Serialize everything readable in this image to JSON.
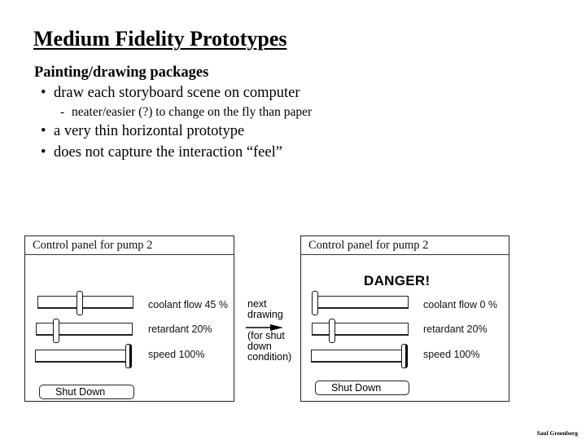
{
  "slide": {
    "title": "Medium Fidelity Prototypes",
    "heading": "Painting/drawing packages",
    "bullet_glyph": "•",
    "sub_glyph": "-",
    "bullets": [
      {
        "text": "draw each storyboard scene on computer",
        "sub": [
          "neater/easier (?) to change on the fly than paper"
        ]
      },
      {
        "text": "a very thin horizontal prototype"
      },
      {
        "text": "does not capture the interaction “feel”"
      }
    ],
    "credit": "Saul Greenberg"
  },
  "storyboard": {
    "transition": {
      "lines": [
        "next",
        "drawing",
        "(for shut",
        "down",
        "condition)"
      ],
      "icon": "arrow-right-icon"
    },
    "panels": [
      {
        "title": "Control panel for pump 2",
        "warning": "",
        "sliders": [
          {
            "label": "coolant flow 45 %",
            "value": 45
          },
          {
            "label": "retardant 20%",
            "value": 20
          },
          {
            "label": "speed 100%",
            "value": 100
          }
        ],
        "button_label": "Shut Down"
      },
      {
        "title": "Control panel for pump 2",
        "warning": "DANGER!",
        "sliders": [
          {
            "label": "coolant flow 0 %",
            "value": 0
          },
          {
            "label": "retardant 20%",
            "value": 20
          },
          {
            "label": "speed 100%",
            "value": 100
          }
        ],
        "button_label": "Shut Down"
      }
    ]
  }
}
